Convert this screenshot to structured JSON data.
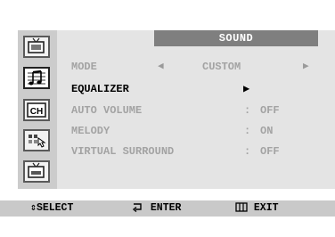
{
  "menu": {
    "title": "SOUND",
    "items": [
      {
        "label": "MODE",
        "value": "CUSTOM",
        "arrow_left": "◀",
        "arrow_right": "▶"
      },
      {
        "label": "EQUALIZER",
        "pointer": "▶"
      },
      {
        "label": "AUTO VOLUME",
        "sep": ":",
        "value": "OFF"
      },
      {
        "label": "MELODY",
        "sep": ":",
        "value": "ON"
      },
      {
        "label": "VIRTUAL SURROUND",
        "sep": ":",
        "value": "OFF"
      }
    ]
  },
  "sidebar": {
    "icons": [
      "picture-icon",
      "sound-icon",
      "channel-icon",
      "setup-icon",
      "input-icon"
    ],
    "channel_label": "CH",
    "active": "sound-icon"
  },
  "footer": {
    "select_icon": "⇕",
    "select": "SELECT",
    "enter": "ENTER",
    "exit": "EXIT"
  },
  "colors": {
    "osd_bg": "#e4e4e4",
    "sidebar_bg": "#cccccc",
    "title_bg": "#7f7f7f",
    "active_text": "#000000",
    "inactive_text": "#a3a3a3",
    "footer_bg": "#c9c9c9"
  }
}
